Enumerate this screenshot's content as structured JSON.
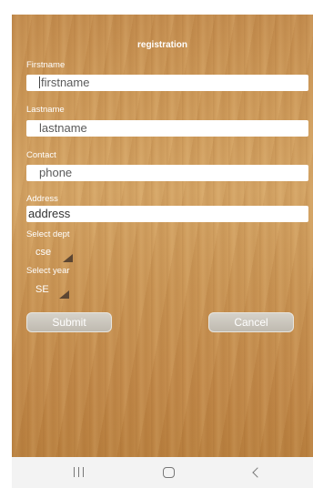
{
  "form": {
    "title": "registration",
    "firstname": {
      "label": "Firstname",
      "value": "firstname"
    },
    "lastname": {
      "label": "Lastname",
      "value": "lastname"
    },
    "contact": {
      "label": "Contact",
      "value": "phone"
    },
    "address": {
      "label": "Address",
      "value": "address"
    },
    "dept": {
      "label": "Select dept",
      "selected": "cse"
    },
    "year": {
      "label": "Select year",
      "selected": "SE"
    },
    "submit_label": "Submit",
    "cancel_label": "Cancel"
  },
  "navbar": {
    "recents_icon": "recents-icon",
    "home_icon": "home-icon",
    "back_icon": "back-icon"
  },
  "colors": {
    "background": "#c99454",
    "text": "#ffffff",
    "button": "#cbc7be",
    "navbar": "#f3f3f3"
  }
}
